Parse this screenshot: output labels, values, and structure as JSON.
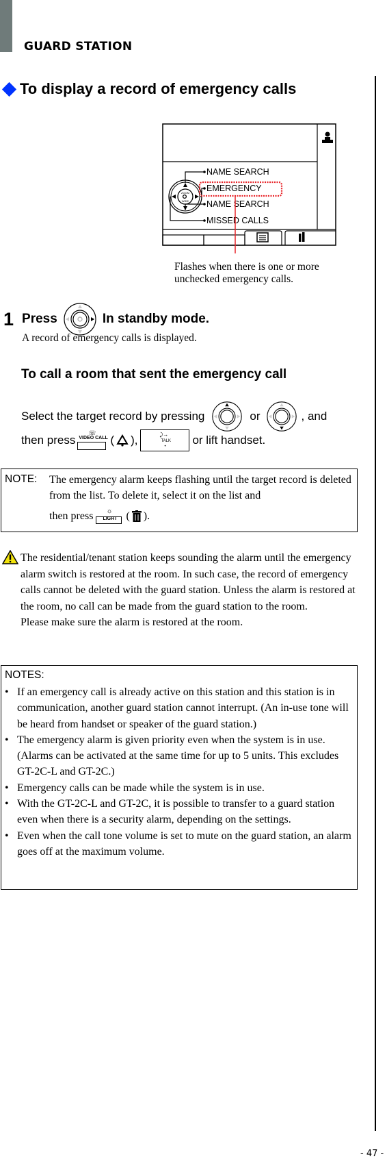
{
  "header": {
    "section": "GUARD STATION"
  },
  "title": "To display a record of emergency calls",
  "screen": {
    "menu_items": [
      "NAME SEARCH",
      "EMERGENCY",
      "NAME SEARCH",
      "MISSED CALLS"
    ],
    "dial_top": "ZOOM",
    "dial_bottom": "WIDE",
    "highlight_color": "#e8262b",
    "icons": [
      "guard-icon",
      "list-icon",
      "settings-icon"
    ]
  },
  "caption": [
    "Flashes when there is one or more",
    "unchecked emergency calls."
  ],
  "step1": {
    "number": "1",
    "press": "Press",
    "rest": "In standby mode.",
    "sub": "A record of emergency calls is displayed."
  },
  "call_room": {
    "heading": "To call a room that sent the emergency call",
    "select_text": "Select the target record by pressing",
    "or": "or",
    "and": ", and",
    "then_press": "then press",
    "video_call_label": "VIDEO CALL",
    "talk_label": "TALK",
    "paren_open": "(",
    "paren_close": "),",
    "lift": "or lift handset."
  },
  "note": {
    "label": "NOTE:",
    "line1": "The emergency alarm keeps flashing until the target record is deleted from the list. To delete it, select it on the list and",
    "then_press": "then press",
    "light_label": "LIGHT",
    "paren_open": "(",
    "paren_close": ")."
  },
  "warning": {
    "text": "The residential/tenant station keeps sounding the alarm until the emergency alarm switch is restored at the room. In such case, the record of emergency calls cannot be deleted with the guard station. Unless the alarm is restored at the room, no call can be made from the guard station to the room.",
    "text2": "Please make sure the alarm is restored at the room."
  },
  "notes": {
    "title": "NOTES:",
    "items": [
      "If an emergency call is already active on this station and this station is in communication, another guard station cannot interrupt. (An in-use tone will be heard from handset or speaker of the guard station.)",
      "The emergency alarm is given priority even when the system is in use. (Alarms can be activated at the same time for up to 5 units. This excludes GT-2C-L and GT-2C.)",
      "Emergency calls can be made while the system is in use.",
      "With the GT-2C-L and GT-2C, it is possible to transfer to a guard station even when there is a security alarm, depending on the settings.",
      "Even when the call tone volume is set to mute on the guard station, an alarm goes off at the maximum volume."
    ]
  },
  "footer": {
    "page": "- 47 -"
  }
}
